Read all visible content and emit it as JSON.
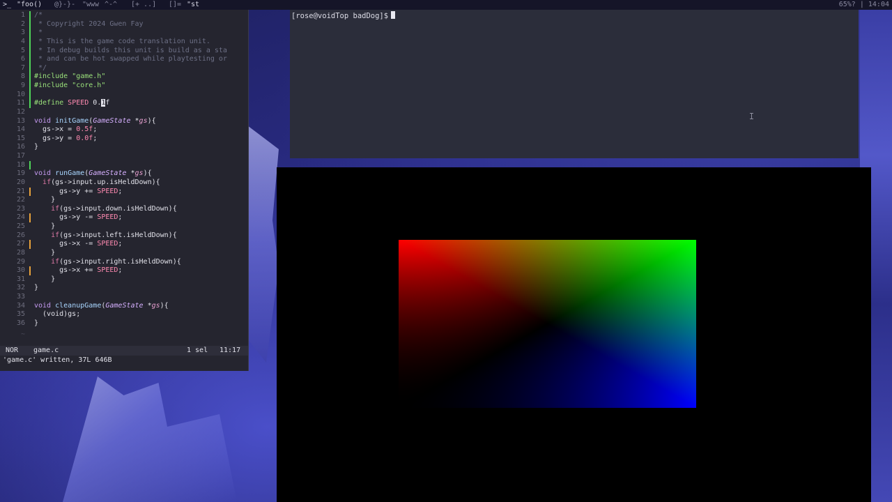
{
  "topbar": {
    "workspaces": [
      ">_",
      "\"foo()",
      "@}-}-",
      "\"www",
      "^-^",
      "[+ ..]",
      "[]=",
      "\"st"
    ],
    "status": "65%? | 14:04"
  },
  "editor": {
    "lines": [
      {
        "n": "1",
        "segs": [
          {
            "c": "cm",
            "t": "/*"
          }
        ],
        "mark": "add"
      },
      {
        "n": "2",
        "segs": [
          {
            "c": "cm",
            "t": " * Copyright 2024 Gwen Fay"
          }
        ],
        "mark": "add"
      },
      {
        "n": "3",
        "segs": [
          {
            "c": "cm",
            "t": " *"
          }
        ],
        "mark": "add"
      },
      {
        "n": "4",
        "segs": [
          {
            "c": "cm",
            "t": " * This is the game code translation unit."
          }
        ],
        "mark": "add"
      },
      {
        "n": "5",
        "segs": [
          {
            "c": "cm",
            "t": " * In debug builds this unit is build as a sta"
          }
        ],
        "mark": "add"
      },
      {
        "n": "6",
        "segs": [
          {
            "c": "cm",
            "t": " * and can be hot swapped while playtesting or"
          }
        ],
        "mark": "add"
      },
      {
        "n": "7",
        "segs": [
          {
            "c": "cm",
            "t": " */"
          }
        ],
        "mark": "add"
      },
      {
        "n": "8",
        "segs": [
          {
            "c": "pp",
            "t": "#include "
          },
          {
            "c": "str",
            "t": "\"game.h\""
          }
        ],
        "mark": "add"
      },
      {
        "n": "9",
        "segs": [
          {
            "c": "pp",
            "t": "#include "
          },
          {
            "c": "str",
            "t": "\"core.h\""
          }
        ],
        "mark": "add"
      },
      {
        "n": "10",
        "segs": [],
        "mark": "add"
      },
      {
        "n": "11",
        "segs": [
          {
            "c": "pp",
            "t": "#define "
          },
          {
            "c": "mac",
            "t": "SPEED"
          },
          {
            "c": "",
            "t": " 0."
          },
          {
            "c": "cursor-block",
            "t": "1"
          },
          {
            "c": "",
            "t": "f"
          }
        ],
        "mark": "add"
      },
      {
        "n": "12",
        "segs": [],
        "mark": ""
      },
      {
        "n": "13",
        "segs": [
          {
            "c": "kw2",
            "t": "void "
          },
          {
            "c": "fn",
            "t": "initGame"
          },
          {
            "c": "",
            "t": "("
          },
          {
            "c": "ty",
            "t": "GameState"
          },
          {
            "c": "",
            "t": " *"
          },
          {
            "c": "pa",
            "t": "gs"
          },
          {
            "c": "",
            "t": "){"
          }
        ],
        "mark": ""
      },
      {
        "n": "14",
        "segs": [
          {
            "c": "",
            "t": "  gs->x = "
          },
          {
            "c": "num",
            "t": "0.5f"
          },
          {
            "c": "",
            "t": ";"
          }
        ],
        "mark": ""
      },
      {
        "n": "15",
        "segs": [
          {
            "c": "",
            "t": "  gs->y = "
          },
          {
            "c": "num",
            "t": "0.0f"
          },
          {
            "c": "",
            "t": ";"
          }
        ],
        "mark": ""
      },
      {
        "n": "16",
        "segs": [
          {
            "c": "",
            "t": "}"
          }
        ],
        "mark": ""
      },
      {
        "n": "17",
        "segs": [],
        "mark": ""
      },
      {
        "n": "18",
        "segs": [],
        "mark": "add"
      },
      {
        "n": "19",
        "segs": [
          {
            "c": "kw2",
            "t": "void "
          },
          {
            "c": "fn",
            "t": "runGame"
          },
          {
            "c": "",
            "t": "("
          },
          {
            "c": "ty",
            "t": "GameState"
          },
          {
            "c": "",
            "t": " *"
          },
          {
            "c": "pa",
            "t": "gs"
          },
          {
            "c": "",
            "t": "){"
          }
        ],
        "mark": ""
      },
      {
        "n": "20",
        "segs": [
          {
            "c": "",
            "t": "  "
          },
          {
            "c": "kw",
            "t": "if"
          },
          {
            "c": "",
            "t": "(gs->input.up.isHeldDown){"
          }
        ],
        "mark": ""
      },
      {
        "n": "21",
        "segs": [
          {
            "c": "",
            "t": "      gs->y += "
          },
          {
            "c": "mac",
            "t": "SPEED"
          },
          {
            "c": "",
            "t": ";"
          }
        ],
        "mark": "mod"
      },
      {
        "n": "22",
        "segs": [
          {
            "c": "",
            "t": "    }"
          }
        ],
        "mark": ""
      },
      {
        "n": "23",
        "segs": [
          {
            "c": "",
            "t": "    "
          },
          {
            "c": "kw",
            "t": "if"
          },
          {
            "c": "",
            "t": "(gs->input.down.isHeldDown){"
          }
        ],
        "mark": ""
      },
      {
        "n": "24",
        "segs": [
          {
            "c": "",
            "t": "      gs->y -= "
          },
          {
            "c": "mac",
            "t": "SPEED"
          },
          {
            "c": "",
            "t": ";"
          }
        ],
        "mark": "mod"
      },
      {
        "n": "25",
        "segs": [
          {
            "c": "",
            "t": "    }"
          }
        ],
        "mark": ""
      },
      {
        "n": "26",
        "segs": [
          {
            "c": "",
            "t": "    "
          },
          {
            "c": "kw",
            "t": "if"
          },
          {
            "c": "",
            "t": "(gs->input.left.isHeldDown){"
          }
        ],
        "mark": ""
      },
      {
        "n": "27",
        "segs": [
          {
            "c": "",
            "t": "      gs->x -= "
          },
          {
            "c": "mac",
            "t": "SPEED"
          },
          {
            "c": "",
            "t": ";"
          }
        ],
        "mark": "mod"
      },
      {
        "n": "28",
        "segs": [
          {
            "c": "",
            "t": "    }"
          }
        ],
        "mark": ""
      },
      {
        "n": "29",
        "segs": [
          {
            "c": "",
            "t": "    "
          },
          {
            "c": "kw",
            "t": "if"
          },
          {
            "c": "",
            "t": "(gs->input.right.isHeldDown){"
          }
        ],
        "mark": ""
      },
      {
        "n": "30",
        "segs": [
          {
            "c": "",
            "t": "      gs->x += "
          },
          {
            "c": "mac",
            "t": "SPEED"
          },
          {
            "c": "",
            "t": ";"
          }
        ],
        "mark": "mod"
      },
      {
        "n": "31",
        "segs": [
          {
            "c": "",
            "t": "    }"
          }
        ],
        "mark": ""
      },
      {
        "n": "32",
        "segs": [
          {
            "c": "",
            "t": "}"
          }
        ],
        "mark": ""
      },
      {
        "n": "33",
        "segs": [],
        "mark": ""
      },
      {
        "n": "34",
        "segs": [
          {
            "c": "kw2",
            "t": "void "
          },
          {
            "c": "fn",
            "t": "cleanupGame"
          },
          {
            "c": "",
            "t": "("
          },
          {
            "c": "ty",
            "t": "GameState"
          },
          {
            "c": "",
            "t": " *"
          },
          {
            "c": "pa",
            "t": "gs"
          },
          {
            "c": "",
            "t": "){"
          }
        ],
        "mark": ""
      },
      {
        "n": "35",
        "segs": [
          {
            "c": "",
            "t": "  (void)gs;"
          }
        ],
        "mark": ""
      },
      {
        "n": "36",
        "segs": [
          {
            "c": "",
            "t": "}"
          }
        ],
        "mark": ""
      }
    ],
    "tilde": "~",
    "statusline": {
      "mode": "NOR",
      "filename": "game.c",
      "selection": "1 sel",
      "position": "11:17"
    },
    "message": "'game.c' written, 37L 646B"
  },
  "terminal": {
    "prompt": "[rose@voidTop badDog]$"
  },
  "game": {
    "corner_colors": {
      "top_left": "#ff0000",
      "top_right": "#00ff00",
      "bottom_right": "#0000ff",
      "bottom_left": "#000000"
    }
  }
}
